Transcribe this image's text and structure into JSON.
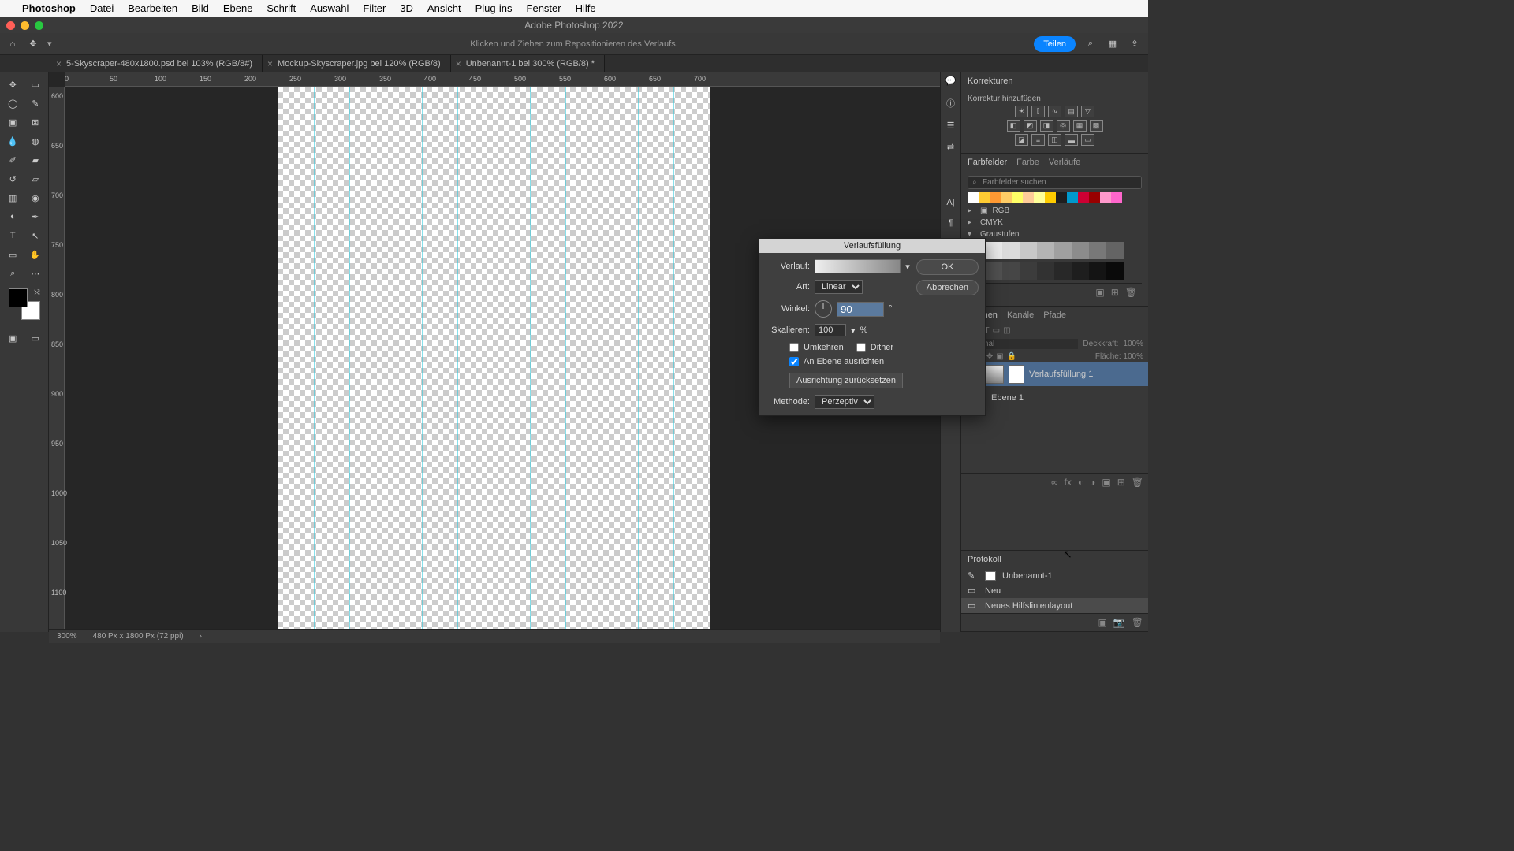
{
  "menu": [
    "Photoshop",
    "Datei",
    "Bearbeiten",
    "Bild",
    "Ebene",
    "Schrift",
    "Auswahl",
    "Filter",
    "3D",
    "Ansicht",
    "Plug-ins",
    "Fenster",
    "Hilfe"
  ],
  "window_title": "Adobe Photoshop 2022",
  "options_hint": "Klicken und Ziehen zum Repositionieren des Verlaufs.",
  "share_label": "Teilen",
  "tabs": [
    {
      "label": "5-Skyscraper-480x1800.psd bei 103% (RGB/8#)",
      "active": false
    },
    {
      "label": "Mockup-Skyscraper.jpg bei 120% (RGB/8)",
      "active": false
    },
    {
      "label": "Unbenannt-1 bei 300% (RGB/8) *",
      "active": true
    }
  ],
  "ruler_h": [
    "0",
    "50",
    "100",
    "150",
    "200",
    "250",
    "300",
    "350",
    "400",
    "450",
    "500",
    "550",
    "600",
    "650",
    "700"
  ],
  "ruler_v": [
    "600",
    "650",
    "700",
    "750",
    "800",
    "850",
    "900",
    "950",
    "1000",
    "1050",
    "1100"
  ],
  "dialog": {
    "title": "Verlaufsfüllung",
    "ok": "OK",
    "cancel": "Abbrechen",
    "gradient_label": "Verlauf:",
    "type_label": "Art:",
    "type_value": "Linear",
    "angle_label": "Winkel:",
    "angle_value": "90",
    "angle_unit": "°",
    "scale_label": "Skalieren:",
    "scale_value": "100",
    "scale_unit": "%",
    "reverse": "Umkehren",
    "dither": "Dither",
    "align": "An Ebene ausrichten",
    "align_checked": true,
    "reset": "Ausrichtung zurücksetzen",
    "method_label": "Methode:",
    "method_value": "Perzeptiv"
  },
  "adjustments": {
    "tab": "Korrekturen",
    "add": "Korrektur hinzufügen"
  },
  "swatches": {
    "tabs": [
      "Farbfelder",
      "Farbe",
      "Verläufe"
    ],
    "search_placeholder": "Farbfelder suchen",
    "row1": [
      "#ffffff",
      "#ffcc33",
      "#ff9933",
      "#ffcc66",
      "#ffff66",
      "#ffcc99",
      "#ffff99",
      "#ffcc00",
      "#1f1f1f",
      "#0099cc",
      "#cc0033",
      "#990000",
      "#ff99cc",
      "#ff66cc"
    ],
    "groups": [
      "RGB",
      "CMYK",
      "Graustufen"
    ],
    "grays1": [
      "#f5f5f5",
      "#eaeaea",
      "#dcdcdc",
      "#c8c8c8",
      "#b4b4b4",
      "#a0a0a0",
      "#8c8c8c",
      "#787878",
      "#646464"
    ],
    "grays2": [
      "#5a5a5a",
      "#505050",
      "#464646",
      "#3c3c3c",
      "#323232",
      "#282828",
      "#1e1e1e",
      "#141414",
      "#0a0a0a"
    ]
  },
  "layers": {
    "tabs": [
      "Ebenen",
      "Kanäle",
      "Pfade"
    ],
    "opacity_label": "Deckkraft:",
    "opacity_value": "100%",
    "fill_label": "Fläche:",
    "fill_value": "100%",
    "blend": "Normal",
    "items": [
      {
        "name": "Verlaufsfüllung 1",
        "active": true,
        "has_mask": true
      },
      {
        "name": "Ebene 1",
        "active": false,
        "has_mask": false
      }
    ]
  },
  "history": {
    "tab": "Protokoll",
    "snapshot": "Unbenannt-1",
    "items": [
      "Neu",
      "Neues Hilfslinienlayout"
    ]
  },
  "status": {
    "zoom": "300%",
    "doc": "480 Px x 1800 Px (72 ppi)"
  }
}
